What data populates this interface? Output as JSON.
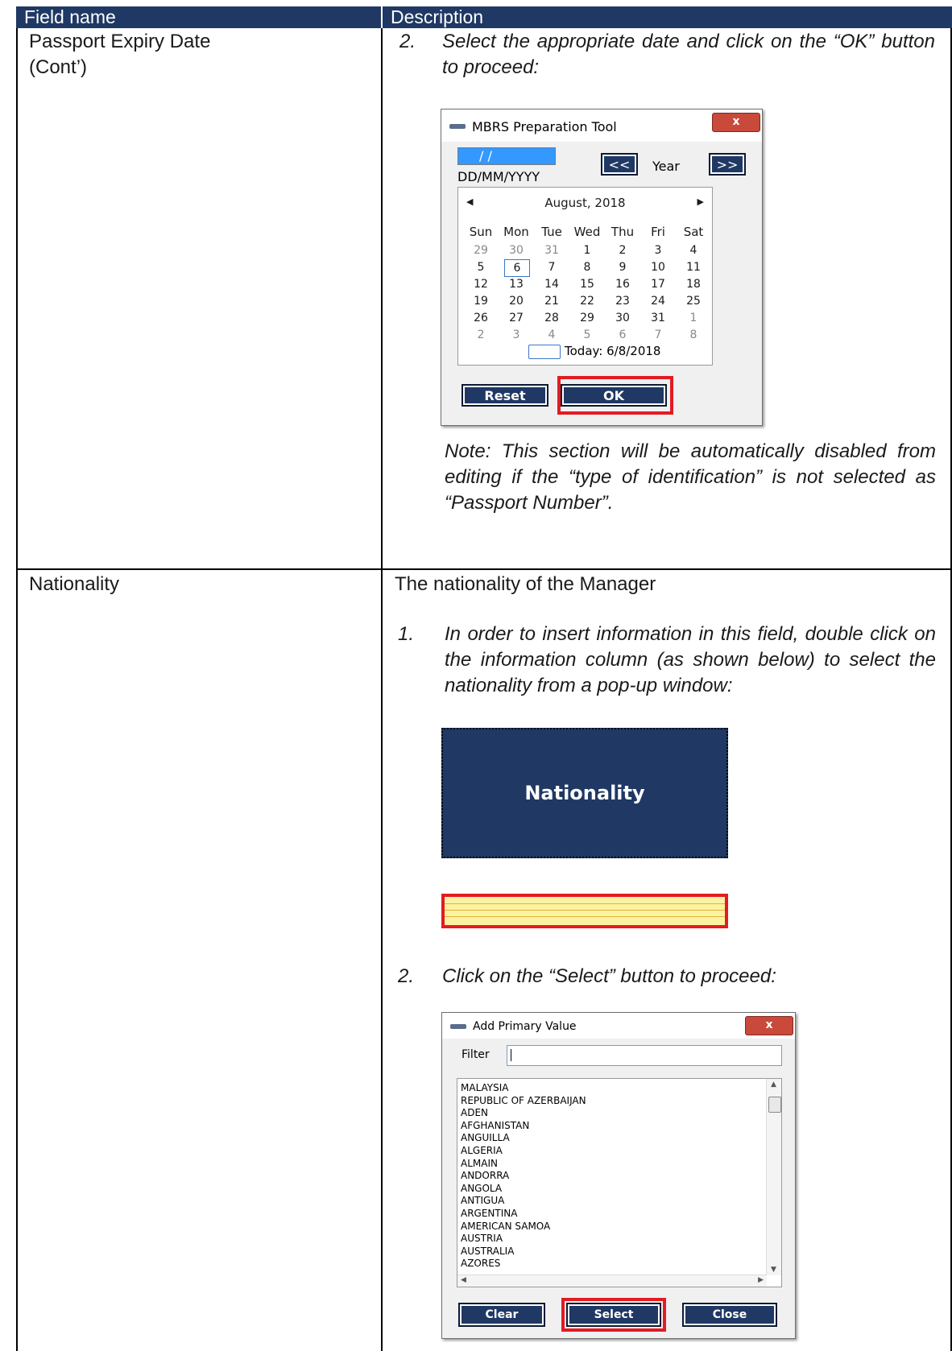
{
  "table": {
    "header": {
      "col1": "Field name",
      "col2": "Description"
    }
  },
  "row1": {
    "field": "Passport Expiry Date",
    "field_cont": "(Cont’)",
    "step_num": "2.",
    "step_text": "Select the appropriate date and click on the “OK” button to proceed:",
    "note": "Note: This section will be automatically disabled from editing if the “type of identification” is not selected as “Passport Number”."
  },
  "date_dialog": {
    "title": "MBRS Preparation Tool",
    "close_label": "x",
    "date_value": "/  /",
    "date_format": "DD/MM/YYYY",
    "prev_label": "<<",
    "year_label": "Year",
    "next_label": ">>",
    "month": "August, 2018",
    "days_of_week": [
      "Sun",
      "Mon",
      "Tue",
      "Wed",
      "Thu",
      "Fri",
      "Sat"
    ],
    "weeks": [
      [
        "29",
        "30",
        "31",
        "1",
        "2",
        "3",
        "4"
      ],
      [
        "5",
        "6",
        "7",
        "8",
        "9",
        "10",
        "11"
      ],
      [
        "12",
        "13",
        "14",
        "15",
        "16",
        "17",
        "18"
      ],
      [
        "19",
        "20",
        "21",
        "22",
        "23",
        "24",
        "25"
      ],
      [
        "26",
        "27",
        "28",
        "29",
        "30",
        "31",
        "1"
      ],
      [
        "2",
        "3",
        "4",
        "5",
        "6",
        "7",
        "8"
      ]
    ],
    "today": "Today: 6/8/2018",
    "reset_label": "Reset",
    "ok_label": "OK",
    "highlight_color": "#e31b23"
  },
  "row2": {
    "field": "Nationality",
    "description": "The nationality of the Manager",
    "step1_num": "1.",
    "step1_text": "In order to insert information in this field, double click on the information column (as shown below) to select the nationality from a pop-up window:",
    "column_header": "Nationality",
    "step2_num": "2.",
    "step2_text": "Click on the “Select” button to proceed:"
  },
  "primary_dialog": {
    "title": "Add Primary Value",
    "close_label": "x",
    "filter_label": "Filter",
    "filter_value": "",
    "items": [
      "MALAYSIA",
      "REPUBLIC OF AZERBAIJAN",
      "ADEN",
      "AFGHANISTAN",
      "ANGUILLA",
      "ALGERIA",
      "ALMAIN",
      "ANDORRA",
      "ANGOLA",
      "ANTIGUA",
      "ARGENTINA",
      "AMERICAN SAMOA",
      "AUSTRIA",
      "AUSTRALIA",
      "AZORES"
    ],
    "clear_label": "Clear",
    "select_label": "Select",
    "close_button_label": "Close"
  }
}
